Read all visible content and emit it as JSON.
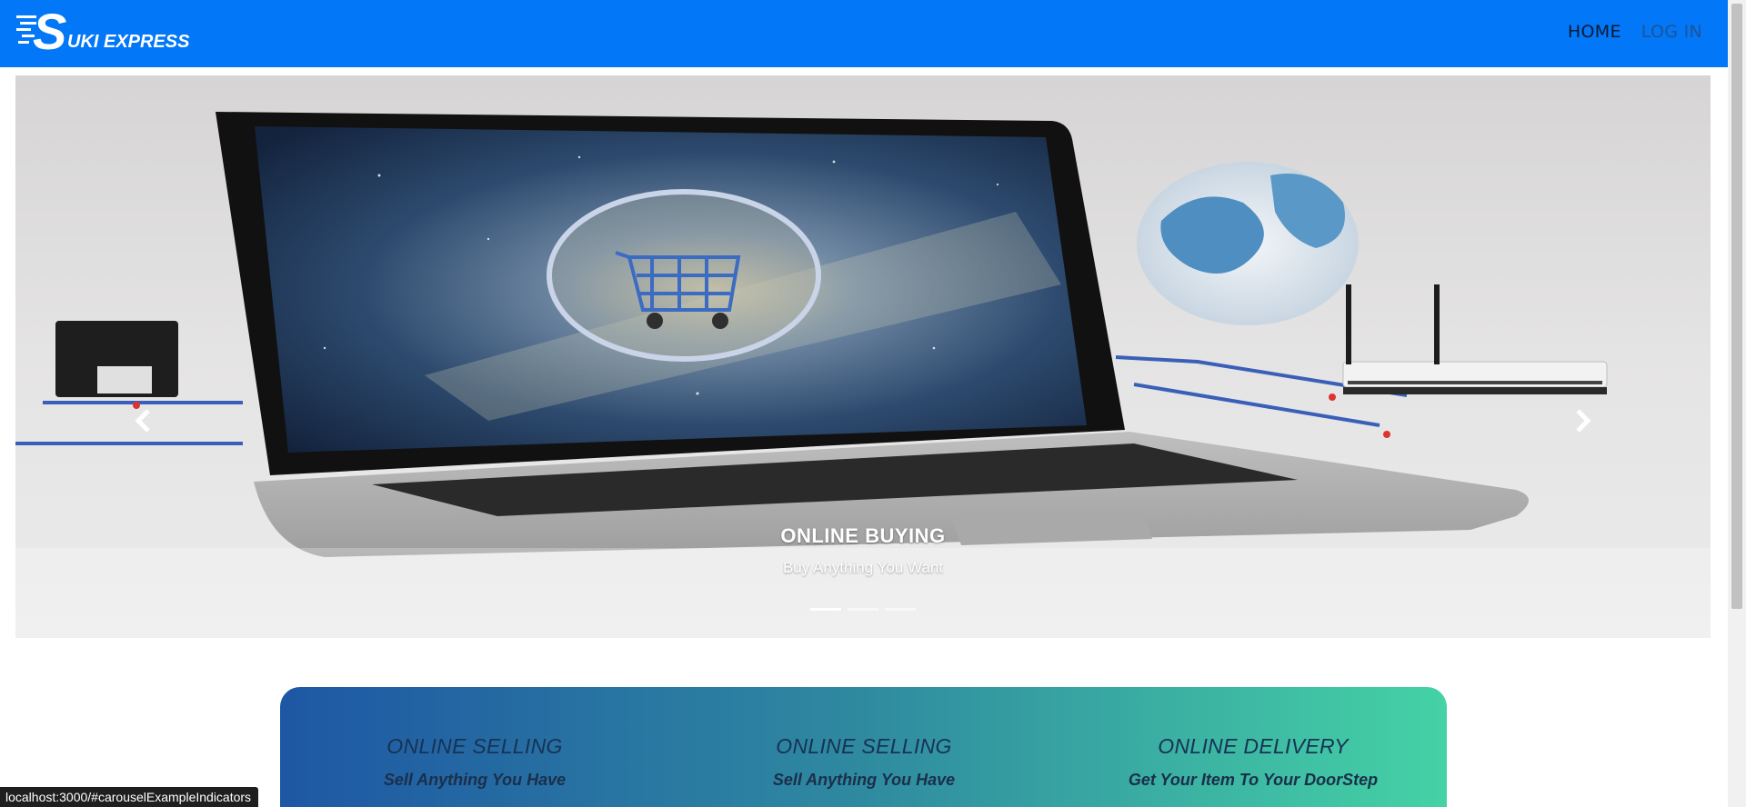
{
  "brand": {
    "logo_letter": "S",
    "logo_text": "UKI EXPRESS",
    "name": "SUKI EXPRESS"
  },
  "nav": {
    "links": [
      {
        "label": "HOME",
        "active": true
      },
      {
        "label": "LOG IN",
        "active": false
      }
    ]
  },
  "carousel": {
    "slide": {
      "title": "ONLINE BUYING",
      "subtitle": "Buy Anything You Want"
    },
    "indicators_count": 3,
    "active_indicator": 0,
    "prev_icon": "chevron-left-icon",
    "next_icon": "chevron-right-icon"
  },
  "features": [
    {
      "title": "ONLINE SELLING",
      "subtitle": "Sell Anything You Have"
    },
    {
      "title": "ONLINE SELLING",
      "subtitle": "Sell Anything You Have"
    },
    {
      "title": "ONLINE DELIVERY",
      "subtitle": "Get Your Item To Your DoorStep"
    }
  ],
  "status_bar": {
    "url": "localhost:3000/#carouselExampleIndicators"
  },
  "colors": {
    "navbar": "#0277f7",
    "gradient_start": "#1e57a4",
    "gradient_end": "#45d2a5"
  }
}
